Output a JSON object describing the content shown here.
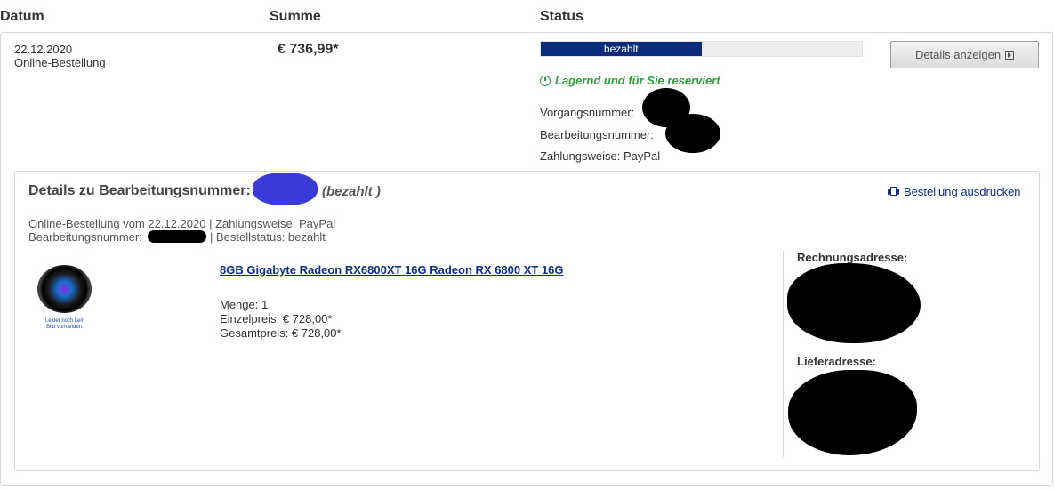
{
  "columns": {
    "date": "Datum",
    "sum": "Summe",
    "status": "Status"
  },
  "order": {
    "date": "22.12.2020",
    "type": "Online-Bestellung",
    "sum": "€ 736,99*",
    "status_label": "bezahlt",
    "progress": 0.5,
    "details_button": "Details anzeigen",
    "stock_text": "Lagernd und für Sie reserviert",
    "vorgang_label": "Vorgangsnummer:",
    "bearbeitung_label": "Bearbeitungsnummer:",
    "payment_label": "Zahlungsweise: PayPal"
  },
  "details": {
    "title": "Details zu Bearbeitungsnummer:",
    "status": "(bezahlt )",
    "print_link": "Bestellung ausdrucken",
    "meta_line1": "Online-Bestellung vom 22.12.2020 | Zahlungsweise: PayPal",
    "meta_line2_prefix": "Bearbeitungsnummer:",
    "meta_line2_suffix": "| Bestellstatus: bezahlt",
    "product": {
      "name": "8GB Gigabyte Radeon RX6800XT 16G Radeon RX 6800 XT 16G",
      "quantity": "Menge: 1",
      "unit_price": "Einzelpreis: € 728,00*",
      "total_price": "Gesamtpreis: € 728,00*",
      "image_placeholder_1": "Leider noch kein",
      "image_placeholder_2": "Bild vorhanden."
    },
    "billing_label": "Rechnungsadresse:",
    "shipping_label": "Lieferadresse:"
  },
  "colors": {
    "progress_fill": "#0a2a7c",
    "stock_green": "#2e9e3a",
    "link_blue": "#0b2f8a"
  },
  "icons": {
    "clock": "clock-icon",
    "print": "printer-icon",
    "external": "open-details-icon"
  }
}
